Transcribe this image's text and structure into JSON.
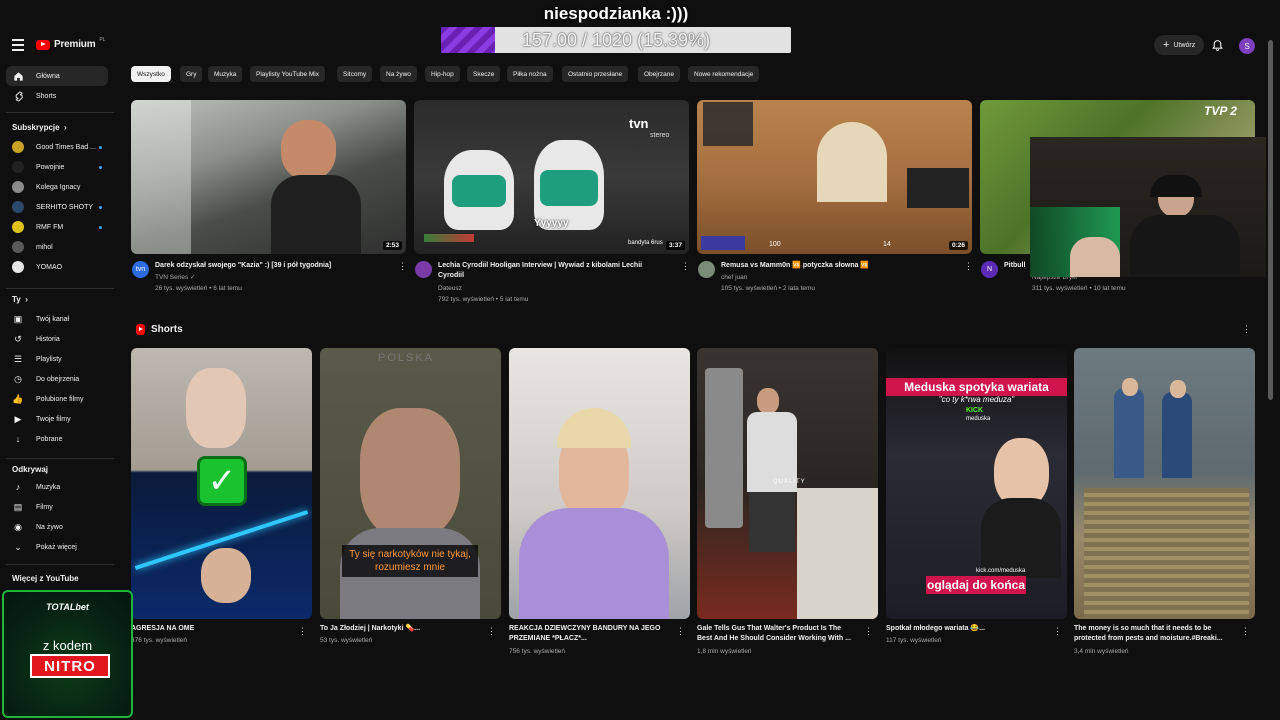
{
  "overlay": {
    "title": "niespodzianka :)))",
    "progress_text": "157.00 / 1020 (15.39%)",
    "progress_value": 0.1539
  },
  "header": {
    "logo": "Premium",
    "logo_country": "PL",
    "create_label": "Utwórz",
    "avatar_letter": "S"
  },
  "sidebar": {
    "main": [
      {
        "label": "Główna",
        "icon": "home-icon"
      },
      {
        "label": "Shorts",
        "icon": "shorts-icon"
      }
    ],
    "subs_title": "Subskrypcje",
    "subs": [
      {
        "label": "Good Times Bad ...",
        "color": "#c9a227"
      },
      {
        "label": "Powojnie",
        "color": "#222222"
      },
      {
        "label": "Kolega Ignacy",
        "color": "#8a8a8a"
      },
      {
        "label": "SERHITO SHOTY",
        "color": "#2b4a6b"
      },
      {
        "label": "RMF FM",
        "color": "#e0c21c"
      },
      {
        "label": "mihol",
        "color": "#5a5a5a"
      },
      {
        "label": "YOMAO",
        "color": "#e6e6e6"
      }
    ],
    "you_title": "Ty",
    "you": [
      {
        "label": "Twój kanał",
        "icon": "channel-icon"
      },
      {
        "label": "Historia",
        "icon": "history-icon"
      },
      {
        "label": "Playlisty",
        "icon": "playlist-icon"
      },
      {
        "label": "Do obejrzenia",
        "icon": "clock-icon"
      },
      {
        "label": "Polubione filmy",
        "icon": "like-icon"
      },
      {
        "label": "Twoje filmy",
        "icon": "video-icon"
      },
      {
        "label": "Pobrane",
        "icon": "download-icon"
      }
    ],
    "explore_title": "Odkrywaj",
    "explore": [
      {
        "label": "Muzyka",
        "icon": "music-icon"
      },
      {
        "label": "Filmy",
        "icon": "film-icon"
      },
      {
        "label": "Na żywo",
        "icon": "live-icon"
      },
      {
        "label": "Pokaż więcej",
        "icon": "chevron-down-icon"
      }
    ],
    "more_title": "Więcej z YouTube"
  },
  "chips": [
    "Wszystko",
    "Gry",
    "Muzyka",
    "Playlisty YouTube Mix",
    "Sitcomy",
    "Na żywo",
    "Hip-hop",
    "Skecze",
    "Piłka nożna",
    "Ostatnio przesłane",
    "Obejrzane",
    "Nowe rekomendacje"
  ],
  "videos": [
    {
      "title": "Darek odzyskał swojego \"Kazia\" :) [39 i pół tygodnia]",
      "channel": "TVN Series",
      "verified": "✓",
      "meta": "26 tys. wyświetleń • 6 lat temu",
      "duration": "2:53",
      "avatar": "tvn",
      "color": "#2d6cdf"
    },
    {
      "title": "Lechia Cyrodiil Hooligan Interview | Wywiad z kibolami Lechii Cyrodiil",
      "channel": "Dateusz",
      "verified": "",
      "meta": "792 tys. wyświetleń • 5 lat temu",
      "duration": "3:37",
      "avatar": "",
      "color": "#7a3aa8"
    },
    {
      "title": "Remusa vs Mamm0n 🆚 potyczka słowna 🆚",
      "channel": "chef juan",
      "verified": "",
      "meta": "105 tys. wyświetleń • 2 lata temu",
      "duration": "0:26",
      "avatar": "",
      "color": "#7a8b7a"
    },
    {
      "title": "Pitbull",
      "channel": "Najlepsze Bryki",
      "verified": "",
      "meta": "311 tys. wyświetleń • 10 lat temu",
      "duration": "",
      "avatar": "N",
      "color": "#5b2bb5"
    }
  ],
  "shorts_title": "Shorts",
  "shorts": [
    {
      "title": "AGRESJA NA OME",
      "meta": "376 tys. wyświetleń"
    },
    {
      "title": "To Ja Złodziej | Narkotyki 💊...",
      "meta": "53 tys. wyświetleń"
    },
    {
      "title": "REAKCJA DZIEWCZYNY BANDURY NA JEGO PRZEMIANE *PŁACZ*...",
      "meta": "756 tys. wyświetleń"
    },
    {
      "title": "Gale Tells Gus That Walter's Product Is The Best And He Should Consider Working With ...",
      "meta": "1,8 mln wyświetleń"
    },
    {
      "title": "Spotkał młodego wariata 😂...",
      "meta": "117 tys. wyświetleń"
    },
    {
      "title": "The money is so much that it needs to be protected from pests and moisture.#Breaki...",
      "meta": "3,4 mln wyświetleń"
    }
  ],
  "thumb_text": {
    "tvn_logo": "tvn",
    "tvn_sub": "stereo",
    "yyyyy": "Yyyyyy",
    "bandyta": "bandyta 6rus",
    "tvp": "TVP 2",
    "cs_stat1": "100",
    "cs_stat2": "14",
    "polska": "POLSKA",
    "narko_caption": "Ty się narkotyków nie tykaj, rozumiesz mnie",
    "quality": "QUALITY",
    "meduska_title": "Meduska spotyka wariata",
    "meduska_sub": "\"co ty k*rwa meduza\"",
    "kick_label": "KICK",
    "kick_user": "meduska",
    "kick_url": "kick.com/meduska",
    "meduska_bottom": "oglądaj do końca"
  },
  "ad": {
    "brand": "TOTALbet",
    "line": "z kodem",
    "code": "NITRO"
  }
}
